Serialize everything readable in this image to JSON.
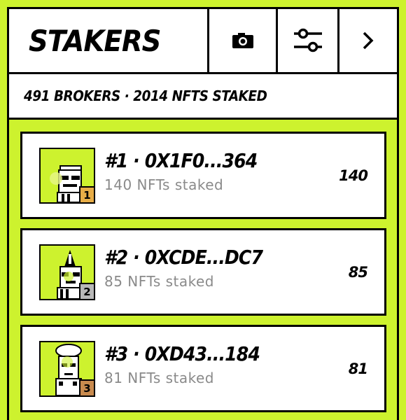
{
  "header": {
    "title": "STAKERS",
    "camera_icon": "camera-icon",
    "filter_icon": "sliders-icon",
    "next_icon": "chevron-right-icon"
  },
  "summary": "491 BROKERS · 2014 NFTS STAKED",
  "colors": {
    "background": "#cdf22e",
    "rank_gold": "#e8ad47",
    "rank_silver": "#b8b8b8",
    "rank_bronze": "#c88a4e",
    "muted_text": "#8a8a8a"
  },
  "stakers": [
    {
      "rank": "1",
      "title": "#1 · 0X1F0...364",
      "subtitle": "140 NFTs staked",
      "count": "140"
    },
    {
      "rank": "2",
      "title": "#2 · 0XCDE...DC7",
      "subtitle": "85 NFTs staked",
      "count": "85"
    },
    {
      "rank": "3",
      "title": "#3 · 0XD43...184",
      "subtitle": "81 NFTs staked",
      "count": "81"
    }
  ]
}
